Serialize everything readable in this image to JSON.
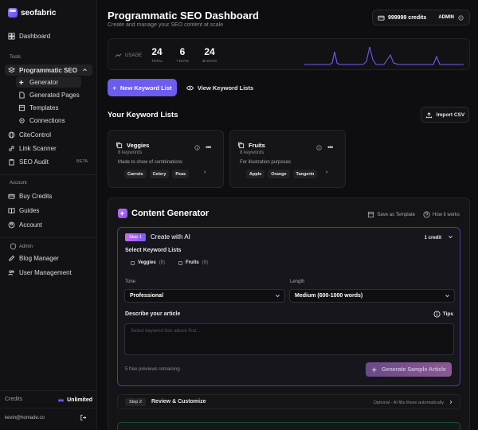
{
  "brand": {
    "name": "seofabric"
  },
  "sidebar": {
    "dashboard": "Dashboard",
    "tools_label": "Tools",
    "programmatic_seo": "Programmatic SEO",
    "generator": "Generator",
    "generated_pages": "Generated Pages",
    "templates": "Templates",
    "connections": "Connections",
    "citecontrol": "CiteControl",
    "link_scanner": "Link Scanner",
    "seo_audit": "SEO Audit",
    "seo_audit_badge": "BETA",
    "account_label": "Account",
    "buy_credits": "Buy Credits",
    "guides": "Guides",
    "account": "Account",
    "admin_label": "Admin",
    "blog_manager": "Blog Manager",
    "user_management": "User Management",
    "credits_label": "Credits",
    "credits_value": "Unlimited",
    "email": "kevin@homade.co"
  },
  "header": {
    "title": "Programmatic SEO Dashboard",
    "subtitle": "Create and manage your SEO content at scale",
    "credits": "999999 credits",
    "role": "ADMIN"
  },
  "usage": {
    "label": "USAGE",
    "stats": [
      {
        "value": "24",
        "caption": "TOTAL"
      },
      {
        "value": "6",
        "caption": "7 DAYS"
      },
      {
        "value": "24",
        "caption": "30 DAYS"
      }
    ],
    "spark_color": "#6c5cf0"
  },
  "actions": {
    "new_list": "New Keyword List",
    "view_lists": "View Keyword Lists",
    "import_csv": "Import CSV"
  },
  "keyword_lists": {
    "title": "Your Keyword Lists",
    "cards": [
      {
        "name": "Veggies",
        "count": "8 keywords",
        "description": "Made to show of combinations",
        "chips": [
          "Carrots",
          "Celery",
          "Peas"
        ]
      },
      {
        "name": "Fruits",
        "count": "8 keywords",
        "description": "For illustration purposes",
        "chips": [
          "Apple",
          "Orange",
          "Tangerin"
        ]
      }
    ]
  },
  "generator": {
    "title": "Content Generator",
    "save_template": "Save as Template",
    "how_it_works": "How it works",
    "step1": {
      "pill": "Step 1",
      "title": "Create with AI",
      "cost": "1 credit",
      "select_lists_label": "Select Keyword Lists",
      "options": [
        {
          "name": "Veggies",
          "count": "(8)"
        },
        {
          "name": "Fruits",
          "count": "(8)"
        }
      ],
      "tone_label": "Tone",
      "tone_value": "Professional",
      "length_label": "Length",
      "length_value": "Medium (600-1000 words)",
      "describe_label": "Describe your article",
      "tips": "Tips",
      "textarea_placeholder": "Select keyword lists above first...",
      "free_previews": "5 free previews remaining",
      "generate_button": "Generate Sample Article"
    },
    "step2": {
      "pill": "Step 2",
      "title": "Review & Customize",
      "note": "Optional - AI fills these automatically"
    }
  }
}
